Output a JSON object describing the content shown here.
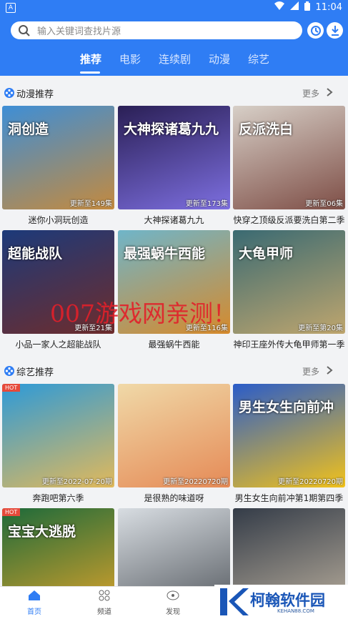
{
  "status": {
    "app_icon_letter": "A",
    "time": "11:04"
  },
  "search": {
    "placeholder": "输入关键词查找片源"
  },
  "tabs": [
    "推荐",
    "电影",
    "连续剧",
    "动漫",
    "综艺"
  ],
  "sections": [
    {
      "title": "动漫推荐",
      "more": "更多",
      "items": [
        {
          "name": "迷你小洞玩创造",
          "badge": "更新至149集",
          "art_text": "洞创造",
          "c1": "#3e8ed6",
          "c2": "#c48a3e"
        },
        {
          "name": "大神探诸葛九九",
          "badge": "更新至173集",
          "art_text": "大神探诸葛九九",
          "c1": "#2a1f55",
          "c2": "#7d6fe0"
        },
        {
          "name": "快穿之顶级反派要洗白第二季",
          "badge": "更新至06集",
          "art_text": "反派洗白",
          "c1": "#d7cfc7",
          "c2": "#7e4e46"
        },
        {
          "name": "小品一家人之超能战队",
          "badge": "更新至21集",
          "art_text": "超能战队",
          "c1": "#1c3a7a",
          "c2": "#6e2c2c"
        },
        {
          "name": "最强蜗牛西能",
          "badge": "更新至116集",
          "art_text": "最强蜗牛西能",
          "c1": "#6fb5c9",
          "c2": "#d68a2c"
        },
        {
          "name": "神印王座外传大龟甲师第一季",
          "badge": "更新至第20集",
          "art_text": "大龟甲师",
          "c1": "#3a6a72",
          "c2": "#bfa66e"
        }
      ]
    },
    {
      "title": "综艺推荐",
      "more": "更多",
      "items": [
        {
          "name": "奔跑吧第六季",
          "badge": "更新至2022-07-20期",
          "art_text": "",
          "hot": "HOT",
          "c1": "#2d9ad8",
          "c2": "#e2b95a"
        },
        {
          "name": "是很熟的味道呀",
          "badge": "更新至20220720期",
          "art_text": "",
          "c1": "#f0d9a8",
          "c2": "#e58a56"
        },
        {
          "name": "男生女生向前冲第1期第四季",
          "badge": "更新至20220720期",
          "art_text": "男生女生向前冲",
          "c1": "#2a5cc9",
          "c2": "#f2c21a"
        },
        {
          "name": "",
          "badge": "",
          "art_text": "宝宝大逃脱",
          "hot": "HOT",
          "c1": "#1d6a3a",
          "c2": "#d9a22b"
        },
        {
          "name": "",
          "badge": "",
          "art_text": "",
          "c1": "#d8dde2",
          "c2": "#555a60"
        },
        {
          "name": "",
          "badge": "",
          "art_text": "",
          "c1": "#343c48",
          "c2": "#b8ad9c"
        }
      ]
    }
  ],
  "watermark": "007游戏网亲测！",
  "bottom_nav": [
    {
      "label": "首页",
      "active": true
    },
    {
      "label": "频道"
    },
    {
      "label": "发现"
    }
  ],
  "logo": {
    "text": "柯翰软件园",
    "sub": "KEHAN88.COM"
  },
  "colors": {
    "primary": "#2f7df4"
  }
}
